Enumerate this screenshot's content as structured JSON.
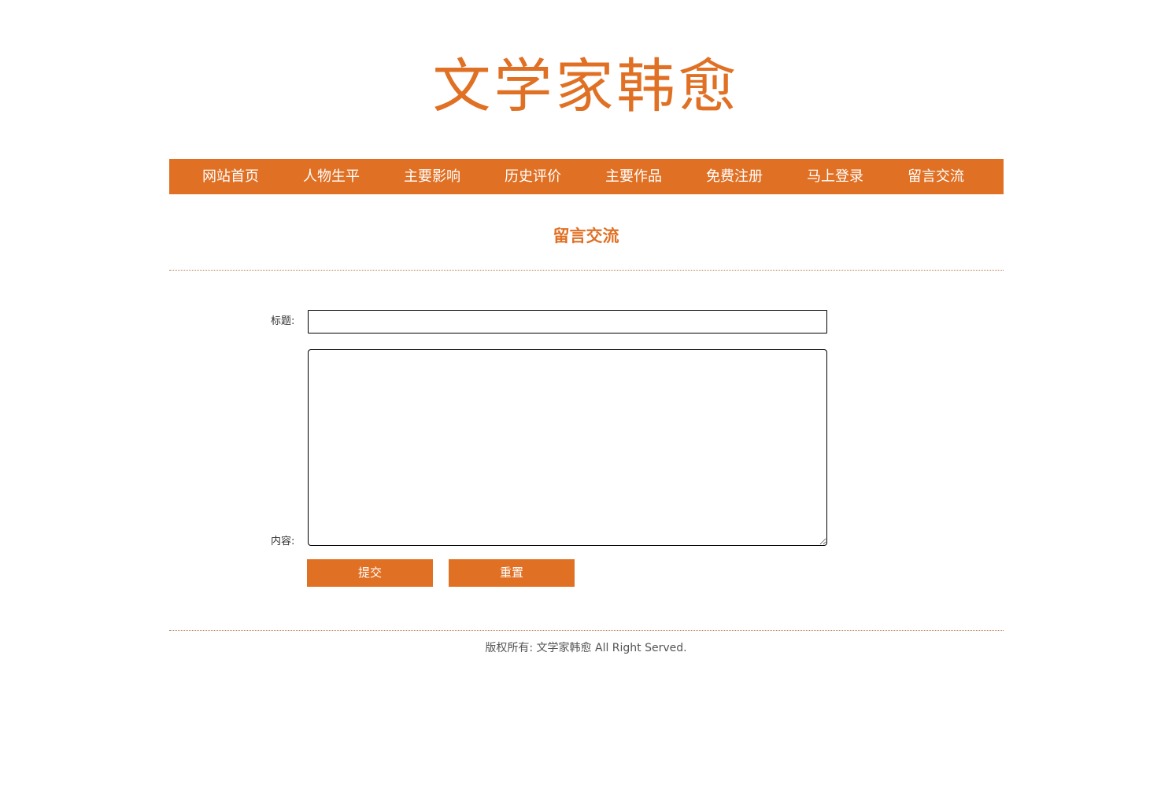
{
  "header": {
    "logo_text": "文学家韩愈"
  },
  "nav": {
    "items": [
      {
        "label": "网站首页"
      },
      {
        "label": "人物生平"
      },
      {
        "label": "主要影响"
      },
      {
        "label": "历史评价"
      },
      {
        "label": "主要作品"
      },
      {
        "label": "免费注册"
      },
      {
        "label": "马上登录"
      },
      {
        "label": "留言交流"
      }
    ]
  },
  "main": {
    "section_title": "留言交流",
    "form": {
      "title_label": "标题:",
      "title_value": "",
      "content_label": "内容:",
      "content_value": "",
      "submit_label": "提交",
      "reset_label": "重置"
    }
  },
  "footer": {
    "copyright": "版权所有: 文学家韩愈 All Right Served."
  },
  "colors": {
    "accent": "#e07024",
    "text": "#333333",
    "footer_text": "#555555",
    "divider": "#b87a4f"
  }
}
